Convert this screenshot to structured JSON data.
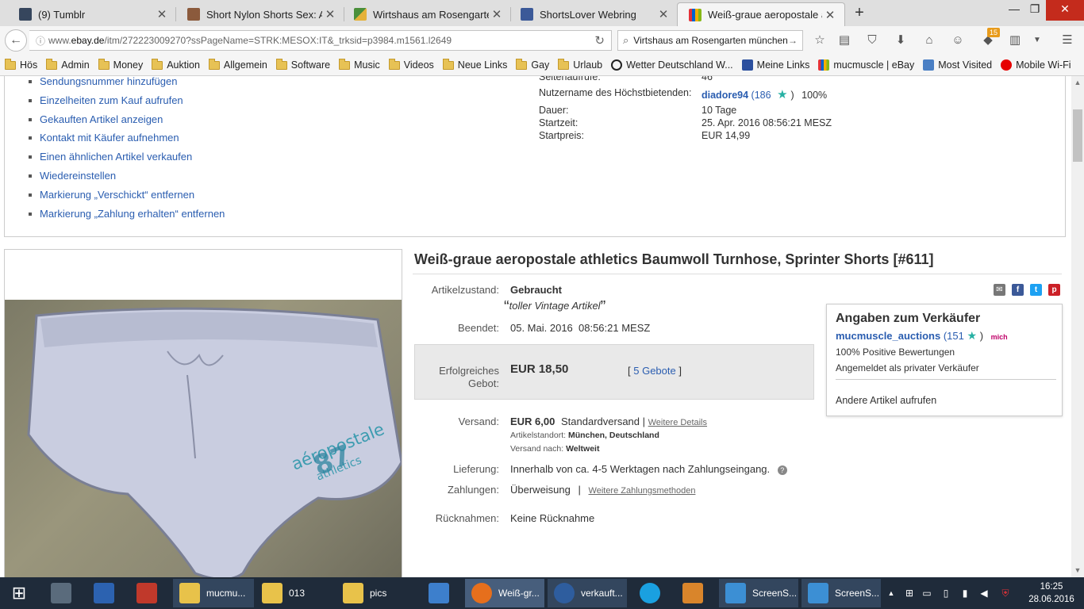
{
  "tabs": [
    {
      "label": "(9) Tumblr",
      "color": "#36465d",
      "active": false
    },
    {
      "label": "Short Nylon Shorts Sex: Ar...",
      "color": "#8b5a3c",
      "active": false
    },
    {
      "label": "Wirtshaus am Rosengarte...",
      "color": "#4a8f3a",
      "active": false
    },
    {
      "label": "ShortsLover Webring",
      "color": "#3b5998",
      "active": false
    },
    {
      "label": "Weiß-graue aeropostale at...",
      "color": "#e53238",
      "active": true
    }
  ],
  "nav": {
    "url_prefix": "www.",
    "url_domain": "ebay.de",
    "url_path": "/itm/272223009270?ssPageName=STRK:MESOX:IT&_trksid=p3984.m1561.l2649",
    "search_value": "Virtshaus am Rosengarten münchen",
    "badge_count": "15"
  },
  "bookmarks": [
    "Hös",
    "Admin",
    "Money",
    "Auktion",
    "Allgemein",
    "Software",
    "Music",
    "Videos",
    "Neue Links",
    "Gay",
    "Urlaub",
    "Wetter Deutschland W...",
    "Meine Links",
    "mucmuscle | eBay",
    "Most Visited",
    "Mobile Wi-Fi"
  ],
  "actions": [
    "Sendungsnummer hinzufügen",
    "Einzelheiten zum Kauf aufrufen",
    "Gekauften Artikel anzeigen",
    "Kontakt mit Käufer aufnehmen",
    "Einen ähnlichen Artikel verkaufen",
    "Wiedereinstellen",
    "Markierung „Verschickt“ entfernen",
    "Markierung „Zahlung erhalten“ entfernen"
  ],
  "stats": {
    "views_label": "Seitenaufrufe:",
    "views_value": "46",
    "bidder_label": "Nutzername des Höchstbietenden:",
    "bidder_name": "diadore94",
    "bidder_score": "(186",
    "bidder_close": ")",
    "bidder_percent": "100%",
    "duration_label": "Dauer:",
    "duration_value": "10 Tage",
    "start_label": "Startzeit:",
    "start_value": "25. Apr. 2016 08:56:21 MESZ",
    "price_label": "Startpreis:",
    "price_value": "EUR 14,99"
  },
  "item": {
    "title": "Weiß-graue aeropostale athletics Baumwoll Turnhose, Sprinter Shorts [#611]",
    "condition_label": "Artikelzustand:",
    "condition_value": "Gebraucht",
    "quote": "toller Vintage Artikel",
    "ended_label": "Beendet:",
    "ended_value": "05. Mai. 2016  08:56:21 MESZ",
    "bid_label_1": "Erfolgreiches",
    "bid_label_2": "Gebot:",
    "bid_value": "EUR 18,50",
    "bids_open": "[",
    "bids_link": "5 Gebote",
    "bids_close": "]",
    "shipping_label": "Versand:",
    "shipping_price": "EUR 6,00",
    "shipping_type": "Standardversand |",
    "shipping_details": "Weitere Details",
    "location_label": "Artikelstandort:",
    "location_value": "München, Deutschland",
    "ships_to_label": "Versand nach:",
    "ships_to_value": "Weltweit",
    "delivery_label": "Lieferung:",
    "delivery_value": "Innerhalb von ca. 4-5 Werktagen nach Zahlungseingang.",
    "payment_label": "Zahlungen:",
    "payment_value": "Überweisung",
    "payment_sep": "|",
    "payment_more": "Weitere Zahlungsmethoden",
    "returns_label": "Rücknahmen:",
    "returns_value": "Keine Rücknahme",
    "photo_text_1": "aéropostale",
    "photo_text_2": "athletics",
    "photo_text_3": "87"
  },
  "seller": {
    "heading": "Angaben zum Verkäufer",
    "name": "mucmuscle_auctions",
    "score": "(151",
    "score_close": ")",
    "me_badge": "mich",
    "positive": "100% Positive Bewertungen",
    "type": "Angemeldet als privater Verkäufer",
    "other_items": "Andere Artikel aufrufen"
  },
  "taskbar": {
    "items": [
      {
        "label": "",
        "color": "#5a6b7c"
      },
      {
        "label": "",
        "color": "#2c62b0"
      },
      {
        "label": "",
        "color": "#c0392b"
      },
      {
        "label": "mucmu...",
        "color": "#e8c24a"
      },
      {
        "label": "013",
        "color": "#e8c24a"
      },
      {
        "label": "pics",
        "color": "#e8c24a"
      },
      {
        "label": "",
        "color": "#3d7fcc"
      },
      {
        "label": "Weiß-gr...",
        "color": "#e66f1c"
      },
      {
        "label": "verkauft...",
        "color": "#2e5d9e"
      },
      {
        "label": "",
        "color": "#1aa0e0"
      },
      {
        "label": "",
        "color": "#d9852b"
      },
      {
        "label": "ScreenS...",
        "color": "#3c8fd4"
      },
      {
        "label": "ScreenS...",
        "color": "#3c8fd4"
      }
    ],
    "time": "16:25",
    "date": "28.06.2016"
  },
  "colors": {
    "link": "#2a5db0",
    "star": "#26b0a3"
  }
}
